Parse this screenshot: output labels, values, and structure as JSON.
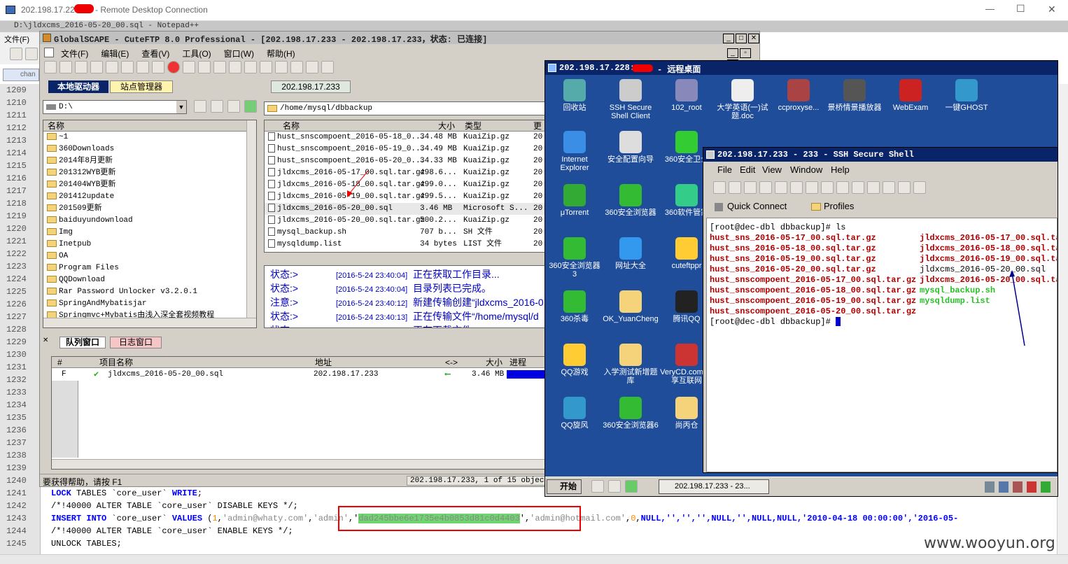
{
  "rdp": {
    "ip": "202.198.17.226",
    "title": "- Remote Desktop Connection",
    "min": "—",
    "max": "☐",
    "close": "✕"
  },
  "notepad": {
    "title": "D:\\jldxcms_2016-05-20_00.sql - Notepad++",
    "menu_file": "文件(F)",
    "tab": "chan",
    "lines": [
      "1209",
      "1210",
      "1211",
      "1212",
      "1213",
      "1214",
      "1215",
      "1216",
      "1217",
      "1218",
      "1219",
      "1220",
      "1221",
      "1222",
      "1223",
      "1224",
      "1225",
      "1226",
      "1227",
      "1228",
      "1229",
      "1230",
      "1231",
      "1232",
      "1233",
      "1234",
      "1235",
      "1236",
      "1237",
      "1238",
      "1239",
      "1240",
      "1241",
      "1242",
      "1243",
      "1244",
      "1245"
    ],
    "code": {
      "l1241_kw": "LOCK",
      "l1241_a": " TABLES `core_user` ",
      "l1241_b": "WRITE",
      ";": ";",
      "l1242": "/*!40000 ALTER TABLE `core_user` DISABLE KEYS */;",
      "l1243_kw1": "INSERT INTO",
      "l1243_t": " `core_user` ",
      "l1243_kw2": "VALUES",
      " l1243_p": " (",
      "l1243_n1": "1",
      "l1243_s1": "'admin@whaty.com'",
      "l1243_s2": "'admin'",
      "l1243_hash": "dad245bbe6e1735e4b0853d81c0d4403",
      "l1243_s3": "'admin@hotmail.com'",
      "l1243_n2": "0",
      "l1243_rest": "NULL,'','','',NULL,'',NULL,NULL,'2010-04-18 00:00:00','2016-05-",
      "l1244": "/*!40000 ALTER TABLE `core_user` ENABLE KEYS */;",
      "l1245": "UNLOCK TABLES;"
    }
  },
  "cuteftp": {
    "title": "GlobalSCAPE - CuteFTP 8.0 Professional - [202.198.17.233 - 202.198.17.233，状态: 已连接]",
    "menu": [
      "文件(F)",
      "编辑(E)",
      "查看(V)",
      "工具(O)",
      "窗口(W)",
      "帮助(H)"
    ],
    "tab_local": "本地驱动器",
    "tab_site": "站点管理器",
    "tab_remote": "202.198.17.233",
    "local_path": "D:\\",
    "remote_path": "/home/mysql/dbbackup",
    "local_col": "名称",
    "local_items": [
      "~1",
      "360Downloads",
      "2014年8月更新",
      "201312WYB更新",
      "201404WYB更新",
      "201412update",
      "201509更新",
      "baiduyundownload",
      "Img",
      "Inetpub",
      "OA",
      "Program Files",
      "QQDownload",
      "Rar Password Unlocker v3.2.0.1",
      "SpringAndMybatisjar",
      "Springmvc+Mybatis由浅入深全套视频教程"
    ],
    "remote_cols": [
      "名称",
      "大小",
      "类型",
      "更"
    ],
    "remote_items": [
      {
        "name": "hust_snscompoent_2016-05-18_0...",
        "size": "34.48 MB",
        "type": "KuaiZip.gz",
        "d": "20:"
      },
      {
        "name": "hust_snscompoent_2016-05-19_0...",
        "size": "34.49 MB",
        "type": "KuaiZip.gz",
        "d": "20:"
      },
      {
        "name": "hust_snscompoent_2016-05-20_0...",
        "size": "34.33 MB",
        "type": "KuaiZip.gz",
        "d": "20:"
      },
      {
        "name": "jldxcms_2016-05-17_00.sql.tar.gz",
        "size": "498.6...",
        "type": "KuaiZip.gz",
        "d": "20:"
      },
      {
        "name": "jldxcms_2016-05-18_00.sql.tar.gz",
        "size": "499.0...",
        "type": "KuaiZip.gz",
        "d": "20:"
      },
      {
        "name": "jldxcms_2016-05-19_00.sql.tar.gz",
        "size": "499.5...",
        "type": "KuaiZip.gz",
        "d": "20:"
      },
      {
        "name": "jldxcms_2016-05-20_00.sql",
        "size": "3.46 MB",
        "type": "Microsoft S...",
        "d": "20:"
      },
      {
        "name": "jldxcms_2016-05-20_00.sql.tar.gz",
        "size": "500.2...",
        "type": "KuaiZip.gz",
        "d": "20:"
      },
      {
        "name": "mysql_backup.sh",
        "size": "707 b...",
        "type": "SH 文件",
        "d": "20:"
      },
      {
        "name": "mysqldump.list",
        "size": "34 bytes",
        "type": "LIST 文件",
        "d": "20:"
      }
    ],
    "log": [
      {
        "k": "状态:>",
        "t": "[2016-5-24 23:40:04]",
        "m": "正在获取工作目录..."
      },
      {
        "k": "状态:>",
        "t": "[2016-5-24 23:40:04]",
        "m": "目录列表已完成。"
      },
      {
        "k": "注意:>",
        "t": "[2016-5-24 23:40:12]",
        "m": "新建传输创建“jldxcms_2016-0"
      },
      {
        "k": "状态:>",
        "t": "[2016-5-24 23:40:13]",
        "m": "正在传输文件“/home/mysql/d"
      },
      {
        "k": "状态:>",
        "t": "",
        "m": "正在下载文件..."
      }
    ],
    "queue_tab": "队列窗口",
    "log_tab": "日志窗口",
    "queue_cols": [
      "#",
      "项目名称",
      "地址",
      "<->",
      "大小",
      "进程"
    ],
    "queue_item": {
      "id": "F",
      "name": "jldxcms_2016-05-20_00.sql",
      "addr": "202.198.17.233",
      "arrow": "⟵",
      "size": "3.46 MB"
    },
    "status_left": "要获得帮助，请按 F1",
    "status_right": "202.198.17.233, 1 of 15 object(s"
  },
  "desk": {
    "title_ip": "202.198.17.228:",
    "title_rest": "- 远程桌面",
    "icons": [
      "回收站",
      "SSH Secure Shell Client",
      "102_root",
      "大学英语(一)试题.doc",
      "ccproxyse...",
      "景桥情景播放器",
      "WebExam",
      "一键GHOST",
      "Internet Explorer",
      "安全配置向导",
      "360安全卫士",
      "μTorrent",
      "360安全浏览器",
      "360软件管家",
      "360安全浏览器 3",
      "网址大全",
      "cuteftppr",
      "360杀毒",
      "OK_YuanCheng",
      "腾讯QQ",
      "QQ游戏",
      "入学测试新增题库",
      "VeryCD.com 分享互联网",
      "QQ旋风",
      "360安全浏览器6",
      "尚丙仓"
    ],
    "start": "开始",
    "task": "202.198.17.233 - 23..."
  },
  "ssh": {
    "title": "202.198.17.233 - 233 - SSH Secure Shell",
    "menu": [
      "File",
      "Edit",
      "View",
      "Window",
      "Help"
    ],
    "quick": "Quick Connect",
    "profiles": "Profiles",
    "prompt1": "[root@dec-dbl dbbackup]# ls",
    "left": [
      "hust_sns_2016-05-17_00.sql.tar.gz",
      "hust_sns_2016-05-18_00.sql.tar.gz",
      "hust_sns_2016-05-19_00.sql.tar.gz",
      "hust_sns_2016-05-20_00.sql.tar.gz",
      "hust_snscompoent_2016-05-17_00.sql.tar.gz",
      "hust_snscompoent_2016-05-18_00.sql.tar.gz",
      "hust_snscompoent_2016-05-19_00.sql.tar.gz",
      "hust_snscompoent_2016-05-20_00.sql.tar.gz"
    ],
    "right": [
      "jldxcms_2016-05-17_00.sql.ta",
      "jldxcms_2016-05-18_00.sql.ta",
      "jldxcms_2016-05-19_00.sql.ta",
      "jldxcms_2016-05-20_00.sql",
      "jldxcms_2016-05-20_00.sql.ta",
      "mysql_backup.sh",
      "mysqldump.list"
    ],
    "prompt2": "[root@dec-dbl dbbackup]#"
  },
  "watermark": "www.wooyun.org"
}
